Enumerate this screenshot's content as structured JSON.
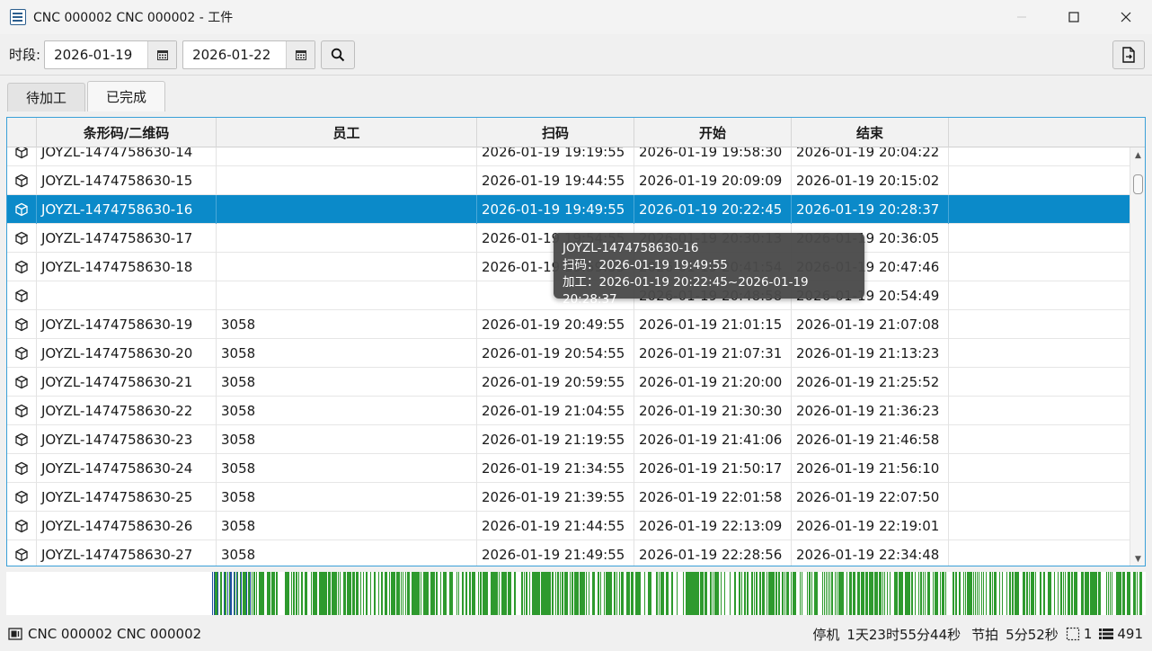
{
  "window": {
    "title": "CNC 000002 CNC 000002 - 工件",
    "app_icon": "table-icon",
    "controls": [
      "minimize",
      "maximize",
      "close"
    ]
  },
  "toolbar": {
    "period_label": "时段:",
    "start_date": "2026-01-19",
    "end_date": "2026-01-22",
    "calendar_icon": "calendar-icon",
    "search_icon": "search-icon",
    "export_icon": "export-document-icon"
  },
  "tabs": [
    {
      "label": "待加工",
      "active": false
    },
    {
      "label": "已完成",
      "active": true
    }
  ],
  "grid": {
    "columns": [
      "",
      "条形码/二维码",
      "员工",
      "扫码",
      "开始",
      "结束",
      ""
    ],
    "row_icon": "cube-icon",
    "selected_index": 2,
    "rows": [
      {
        "code": "JOYZL-1474758630-14",
        "staff": "",
        "scan": "2026-01-19 19:19:55",
        "start": "2026-01-19 19:58:30",
        "end": "2026-01-19 20:04:22"
      },
      {
        "code": "JOYZL-1474758630-15",
        "staff": "",
        "scan": "2026-01-19 19:44:55",
        "start": "2026-01-19 20:09:09",
        "end": "2026-01-19 20:15:02"
      },
      {
        "code": "JOYZL-1474758630-16",
        "staff": "",
        "scan": "2026-01-19 19:49:55",
        "start": "2026-01-19 20:22:45",
        "end": "2026-01-19 20:28:37"
      },
      {
        "code": "JOYZL-1474758630-17",
        "staff": "",
        "scan": "2026-01-19 19:54:55",
        "start": "2026-01-19 20:30:13",
        "end": "2026-01-19 20:36:05"
      },
      {
        "code": "JOYZL-1474758630-18",
        "staff": "",
        "scan": "2026-01-19 19:59:55",
        "start": "2026-01-19 20:41:54",
        "end": "2026-01-19 20:47:46"
      },
      {
        "code": "",
        "staff": "",
        "scan": "",
        "start": "2026-01-19 20:48:58",
        "end": "2026-01-19 20:54:49"
      },
      {
        "code": "JOYZL-1474758630-19",
        "staff": "3058",
        "scan": "2026-01-19 20:49:55",
        "start": "2026-01-19 21:01:15",
        "end": "2026-01-19 21:07:08"
      },
      {
        "code": "JOYZL-1474758630-20",
        "staff": "3058",
        "scan": "2026-01-19 20:54:55",
        "start": "2026-01-19 21:07:31",
        "end": "2026-01-19 21:13:23"
      },
      {
        "code": "JOYZL-1474758630-21",
        "staff": "3058",
        "scan": "2026-01-19 20:59:55",
        "start": "2026-01-19 21:20:00",
        "end": "2026-01-19 21:25:52"
      },
      {
        "code": "JOYZL-1474758630-22",
        "staff": "3058",
        "scan": "2026-01-19 21:04:55",
        "start": "2026-01-19 21:30:30",
        "end": "2026-01-19 21:36:23"
      },
      {
        "code": "JOYZL-1474758630-23",
        "staff": "3058",
        "scan": "2026-01-19 21:19:55",
        "start": "2026-01-19 21:41:06",
        "end": "2026-01-19 21:46:58"
      },
      {
        "code": "JOYZL-1474758630-24",
        "staff": "3058",
        "scan": "2026-01-19 21:34:55",
        "start": "2026-01-19 21:50:17",
        "end": "2026-01-19 21:56:10"
      },
      {
        "code": "JOYZL-1474758630-25",
        "staff": "3058",
        "scan": "2026-01-19 21:39:55",
        "start": "2026-01-19 22:01:58",
        "end": "2026-01-19 22:07:50"
      },
      {
        "code": "JOYZL-1474758630-26",
        "staff": "3058",
        "scan": "2026-01-19 21:44:55",
        "start": "2026-01-19 22:13:09",
        "end": "2026-01-19 22:19:01"
      },
      {
        "code": "JOYZL-1474758630-27",
        "staff": "3058",
        "scan": "2026-01-19 21:49:55",
        "start": "2026-01-19 22:28:56",
        "end": "2026-01-19 22:34:48"
      }
    ]
  },
  "tooltip": {
    "line1": "JOYZL-1474758630-16",
    "line2": "扫码：2026-01-19 19:49:55",
    "line3": "加工：2026-01-19 20:22:45~2026-01-19 20:28:37"
  },
  "timeline": {
    "colors": {
      "done": "#2e9a2e",
      "selected": "#1f4fa0",
      "background": "#ffffff"
    }
  },
  "status": {
    "machine_icon": "machine-icon",
    "machine": "CNC 000002 CNC 000002",
    "stop_label": "停机",
    "stop_value": "1天23时55分44秒",
    "cycle_label": "节拍",
    "cycle_value": "5分52秒",
    "selection_icon": "selection-icon",
    "selection_count": "1",
    "list_icon": "list-icon",
    "total_count": "491"
  }
}
